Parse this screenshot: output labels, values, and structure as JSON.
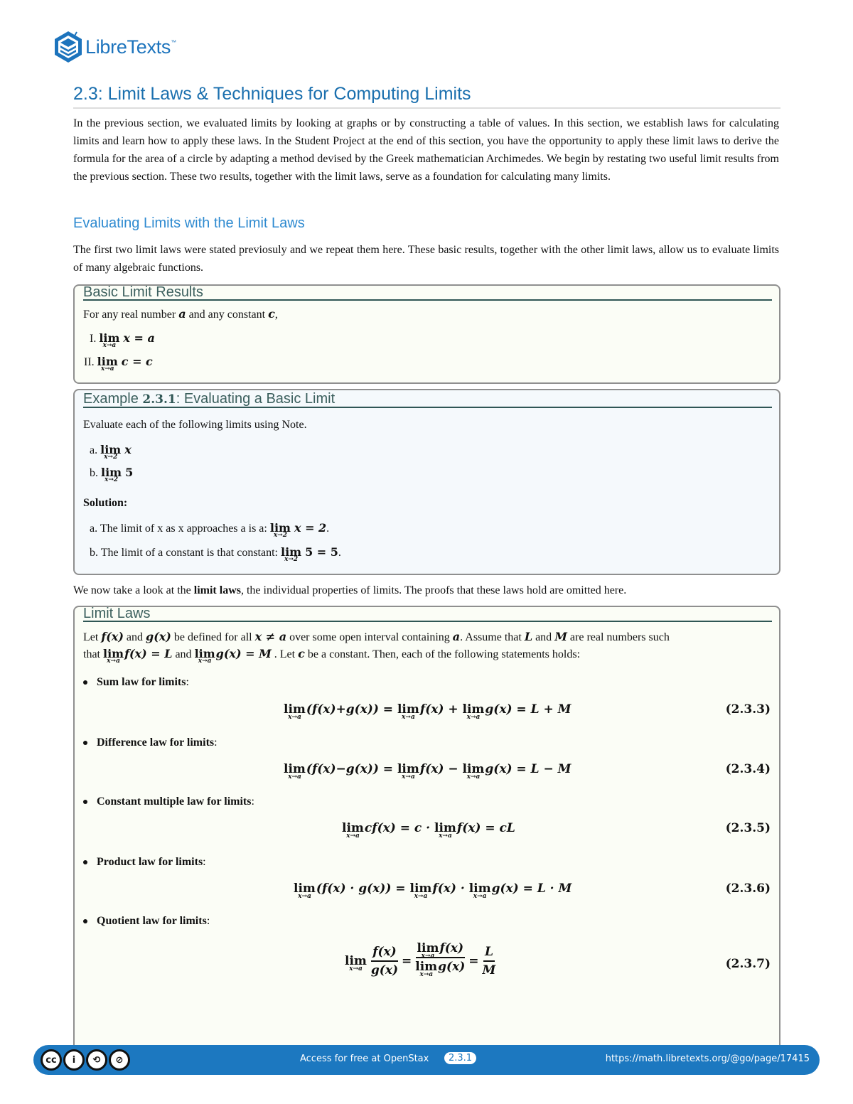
{
  "brand": {
    "name": "LibreTexts",
    "tm": "™",
    "color": "#1d74bd"
  },
  "page_title": "2.3: Limit Laws & Techniques for Computing Limits",
  "intro": "In the previous section, we evaluated limits by looking at graphs or by constructing a table of values. In this section, we establish laws for calculating limits and learn how to apply these laws. In the Student Project at the end of this section, you have the opportunity to apply these limit laws to derive the formula for the area of a circle by adapting a method devised by the Greek mathematician Archimedes. We begin by restating two useful limit results from the previous section. These two results, together with the limit laws, serve as a foundation for calculating many limits.",
  "section": {
    "heading": "Evaluating Limits with the Limit Laws",
    "paragraph": "The first two limit laws were stated previosuly and we repeat them here. These basic results, together with the other limit laws, allow us to evaluate limits of many algebraic functions."
  },
  "note_box": {
    "title": "Basic Limit Results",
    "lead_before": "For any real number ",
    "lead_var1": "a",
    "lead_mid": " and any constant ",
    "lead_var2": "c",
    "lead_after": ",",
    "items": [
      {
        "marker": "I.",
        "lim": "lim",
        "sub": "x→a",
        "expr": "x = a"
      },
      {
        "marker": "II.",
        "lim": "lim",
        "sub": "x→a",
        "expr": "c = c"
      }
    ]
  },
  "example_box": {
    "title_prefix": "Example ",
    "title_number": "2.3.1",
    "title_suffix": ": Evaluating a Basic Limit",
    "prompt": "Evaluate each of the following limits using Note.",
    "items": [
      {
        "marker": "a.",
        "lim": "lim",
        "sub": "x→2",
        "expr": "x"
      },
      {
        "marker": "b.",
        "lim": "lim",
        "sub": "x→2",
        "expr": "5"
      }
    ],
    "solution_label": "Solution:",
    "solutions": [
      {
        "text": "a. The limit of x as x approaches a is a: ",
        "lim": "lim",
        "sub": "x→2",
        "expr": "x = 2",
        "end": "."
      },
      {
        "text": "b. The limit of a constant is that constant: ",
        "lim": "lim",
        "sub": "x→2",
        "expr": "5 = 5",
        "end": "."
      }
    ]
  },
  "transition": {
    "before": "We now take a look at the ",
    "bold": "limit laws",
    "after": ", the individual properties of limits. The proofs that these laws hold are omitted here."
  },
  "laws_box": {
    "title": "Limit Laws",
    "line1": {
      "t1": "Let ",
      "f": "f(x)",
      "t2": " and ",
      "g": "g(x)",
      "t3": " be defined for all ",
      "cond": "x ≠ a",
      "t4": " over some open interval containing ",
      "a": "a",
      "t5": ". Assume that ",
      "L": "L",
      "t6": " and ",
      "M": "M",
      "t7": " are real numbers such"
    },
    "line2": {
      "t1": "that ",
      "lim": "lim",
      "sub": "x→a",
      "e1": "f(x) = L",
      "t2": " and ",
      "e2": "g(x) = M",
      "t3": " . Let ",
      "c": "c",
      "t4": " be a constant. Then, each of the following statements holds:"
    },
    "laws": [
      {
        "label": "Sum law for limits",
        "number": "(2.3.3)",
        "lim": "lim",
        "sub": "x→a",
        "p1": "(f(x)+g(x)) = ",
        "p2": "f(x) + ",
        "p3": "g(x) = L + M"
      },
      {
        "label": "Difference law for limits",
        "number": "(2.3.4)",
        "lim": "lim",
        "sub": "x→a",
        "p1": "(f(x)−g(x)) = ",
        "p2": "f(x) − ",
        "p3": "g(x) = L − M"
      },
      {
        "label": "Constant multiple law for limits",
        "number": "(2.3.5)",
        "lim": "lim",
        "sub": "x→a",
        "p1": "cf(x) = c · ",
        "p2": "f(x) = cL"
      },
      {
        "label": "Product law for limits",
        "number": "(2.3.6)",
        "lim": "lim",
        "sub": "x→a",
        "p1": "(f(x) · g(x)) = ",
        "p2": "f(x) · ",
        "p3": "g(x) = L · M"
      },
      {
        "label": "Quotient law for limits",
        "number": "(2.3.7)",
        "lim": "lim",
        "sub": "x→a",
        "num1": "f(x)",
        "den1": "g(x)",
        "num2": "f(x)",
        "den2": "g(x)",
        "num3": "L",
        "den3": "M",
        "eq": "="
      }
    ],
    "label_suffix": ":"
  },
  "footer": {
    "license_icons": [
      "cc-icon",
      "by-icon",
      "sa-icon",
      "nc-icon"
    ],
    "license_glyphs": [
      "cc",
      "i",
      "⟲",
      "⊘"
    ],
    "center_text": "Access for free at OpenStax",
    "page_number": "2.3.1",
    "url": "https://math.libretexts.org/@go/page/17415",
    "color": "#1c78c0"
  }
}
